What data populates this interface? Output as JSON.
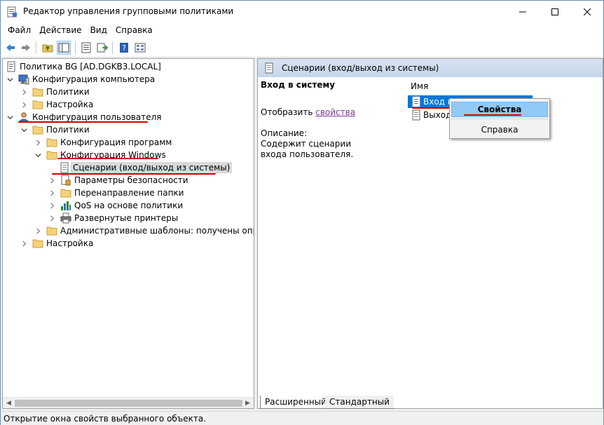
{
  "window": {
    "title": "Редактор управления групповыми политиками"
  },
  "menu": [
    "Файл",
    "Действие",
    "Вид",
    "Справка"
  ],
  "tree": {
    "root": "Политика BG [AD.DGKB3.LOCAL]",
    "computer_config": "Конфигурация компьютера",
    "cc_policies": "Политики",
    "cc_settings": "Настройка",
    "user_config": "Конфигурация пользователя",
    "uc_policies": "Политики",
    "software_config": "Конфигурация программ",
    "windows_config": "Конфигурация Windows",
    "scripts": "Сценарии (вход/выход из системы)",
    "security": "Параметры безопасности",
    "folder_redirect": "Перенаправление папки",
    "qos": "QoS на основе политики",
    "printers": "Развернутые принтеры",
    "admin_templates": "Административные шаблоны: получены определ",
    "uc_settings": "Настройка"
  },
  "right": {
    "header": "Сценарии (вход/выход из системы)",
    "desc_title": "Вход в систему",
    "show_prefix": "Отобразить ",
    "show_link": "свойства",
    "description_label": "Описание:",
    "description_text": "Содержит сценарии входа пользователя.",
    "column_name": "Имя",
    "items": [
      "Вход в с",
      "Выход и"
    ]
  },
  "context_menu": {
    "properties": "Свойства",
    "help": "Справка"
  },
  "tabs": {
    "extended": "Расширенный",
    "standard": "Стандартный"
  },
  "status": "Открытие окна свойств выбранного объекта.",
  "colors": {
    "annotation_red": "#d40000",
    "selection_blue": "#0078d7",
    "menu_highlight": "#91c9f7",
    "link_purple": "#7b3a95"
  }
}
